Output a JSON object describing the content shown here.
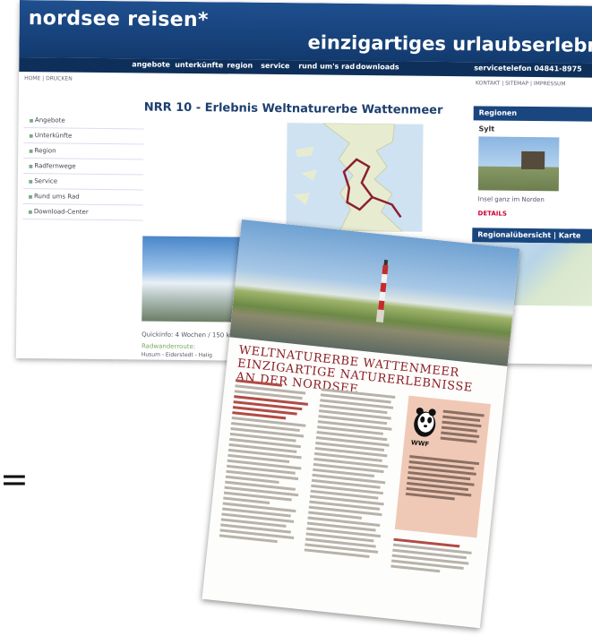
{
  "website": {
    "brand": "nordsee reisen*",
    "tagline": "einzigartiges urlaubserlebnis",
    "nav": [
      "angebote",
      "unterkünfte",
      "region",
      "service",
      "rund um's rad",
      "downloads"
    ],
    "service_phone": "servicetelefon 04841-8975",
    "breadcrumb": "HOME | DRUCKEN",
    "meta_links": "KONTAKT | SITEMAP | IMPRESSUM",
    "sidebar": [
      "Angebote",
      "Unterkünfte",
      "Region",
      "Radfernwege",
      "Service",
      "Rund ums Rad",
      "Download-Center"
    ],
    "page_title": "NRR 10 - Erlebnis Weltnaturerbe Wattenmeer",
    "caption": "Quickinfo: 4 Wochen / 150 km",
    "route_label": "Radwanderroute:",
    "route_stops": "Husum - Eiderstedt - Halig",
    "regions_header": "Regionen",
    "region_name": "Sylt",
    "region_caption": "Insel ganz im Norden",
    "region_link": "DETAILS",
    "map_header": "Regionalübersicht | Karte"
  },
  "brochure": {
    "title": "Weltnaturerbe Wattenmeer einzigartige Naturerlebnisse an der Nordsee",
    "wwf_label": "WWF"
  },
  "glyph": "=",
  "colors": {
    "header_blue": "#1f4f8f",
    "nav_blue": "#0e2f5a",
    "brochure_title": "#8b1d24",
    "wwf_box": "#f0c9b6"
  },
  "icons": [
    "wwf-panda-icon",
    "lighthouse-icon",
    "route-map-icon"
  ]
}
